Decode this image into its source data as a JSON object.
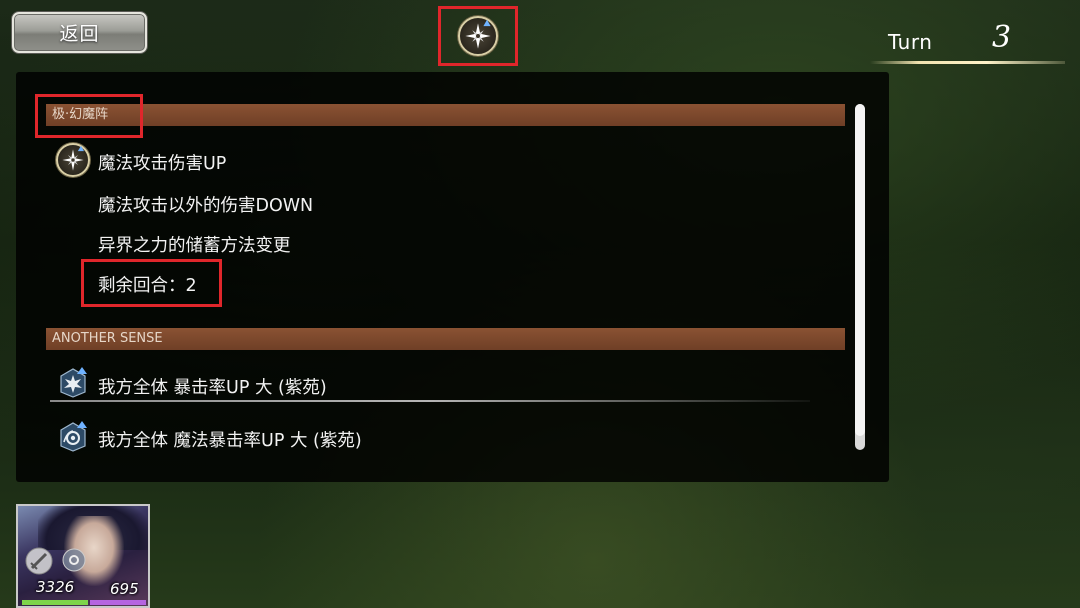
{
  "header": {
    "back_label": "返回",
    "turn_label": "Turn",
    "turn_value": "3"
  },
  "panel": {
    "section1": {
      "title": "极·幻魔阵",
      "lines": [
        "魔法攻击伤害UP",
        "魔法攻击以外的伤害DOWN",
        "异界之力的储蓄方法变更",
        "剩余回合：2"
      ]
    },
    "section2": {
      "title": "ANOTHER SENSE",
      "lines": [
        "我方全体 暴击率UP 大 (紫苑)",
        "我方全体 魔法暴击率UP 大 (紫苑)"
      ]
    }
  },
  "character": {
    "hp": "3326",
    "mp": "695"
  },
  "icons": {
    "top": "compass-star-icon",
    "buff": "compass-star-icon",
    "sense1": "critical-up-icon",
    "sense2": "magic-critical-up-icon"
  },
  "colors": {
    "highlight": "#e0262b",
    "section_bar": "#7a4a2c",
    "hp_bar": "#7dd44a",
    "mp_bar": "#b565e0"
  }
}
